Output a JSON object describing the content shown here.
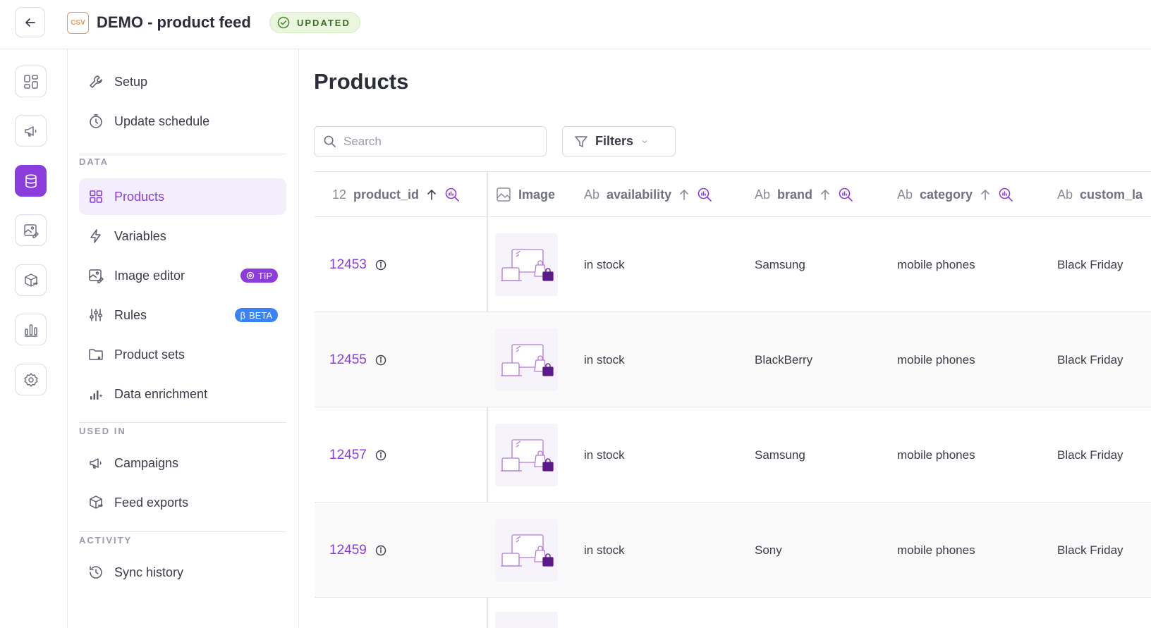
{
  "header": {
    "file_type": "CSV",
    "title": "DEMO - product feed",
    "status": "UPDATED"
  },
  "colors": {
    "accent": "#8b3ddc",
    "beta": "#3b82f6",
    "status_bg": "#ebf6df"
  },
  "rail": {
    "items": [
      "dashboard-icon",
      "megaphone-icon",
      "database-icon",
      "image-edit-icon",
      "box-export-icon",
      "bar-chart-icon",
      "gear-icon"
    ],
    "active": "database-icon"
  },
  "sidebar": {
    "top_items": [
      {
        "label": "Setup",
        "icon": "wrench-icon"
      },
      {
        "label": "Update schedule",
        "icon": "timer-icon"
      }
    ],
    "data_label": "DATA",
    "data_items": [
      {
        "label": "Products",
        "icon": "grid-icon",
        "active": true
      },
      {
        "label": "Variables",
        "icon": "bolt-icon"
      },
      {
        "label": "Image editor",
        "icon": "image-edit-icon",
        "badge": "TIP"
      },
      {
        "label": "Rules",
        "icon": "sliders-icon",
        "badge": "BETA"
      },
      {
        "label": "Product sets",
        "icon": "folder-icon"
      },
      {
        "label": "Data enrichment",
        "icon": "chart-sparkle-icon"
      }
    ],
    "used_in_label": "USED IN",
    "used_in_items": [
      {
        "label": "Campaigns",
        "icon": "megaphone-icon"
      },
      {
        "label": "Feed exports",
        "icon": "box-export-icon"
      }
    ],
    "activity_label": "ACTIVITY",
    "activity_items": [
      {
        "label": "Sync history",
        "icon": "history-icon"
      }
    ]
  },
  "main": {
    "title": "Products",
    "search_placeholder": "Search",
    "filters_label": "Filters",
    "columns": [
      {
        "label": "product_id",
        "type_icon": "12"
      },
      {
        "label": "Image",
        "type_icon": "image-icon"
      },
      {
        "label": "availability",
        "type_icon": "Ab"
      },
      {
        "label": "brand",
        "type_icon": "Ab"
      },
      {
        "label": "category",
        "type_icon": "Ab"
      },
      {
        "label": "custom_la",
        "type_icon": "Ab"
      }
    ],
    "rows": [
      {
        "product_id": "12453",
        "availability": "in stock",
        "brand": "Samsung",
        "category": "mobile phones",
        "custom_label": "Black Friday"
      },
      {
        "product_id": "12455",
        "availability": "in stock",
        "brand": "BlackBerry",
        "category": "mobile phones",
        "custom_label": "Black Friday"
      },
      {
        "product_id": "12457",
        "availability": "in stock",
        "brand": "Samsung",
        "category": "mobile phones",
        "custom_label": "Black Friday"
      },
      {
        "product_id": "12459",
        "availability": "in stock",
        "brand": "Sony",
        "category": "mobile phones",
        "custom_label": "Black Friday"
      }
    ]
  }
}
